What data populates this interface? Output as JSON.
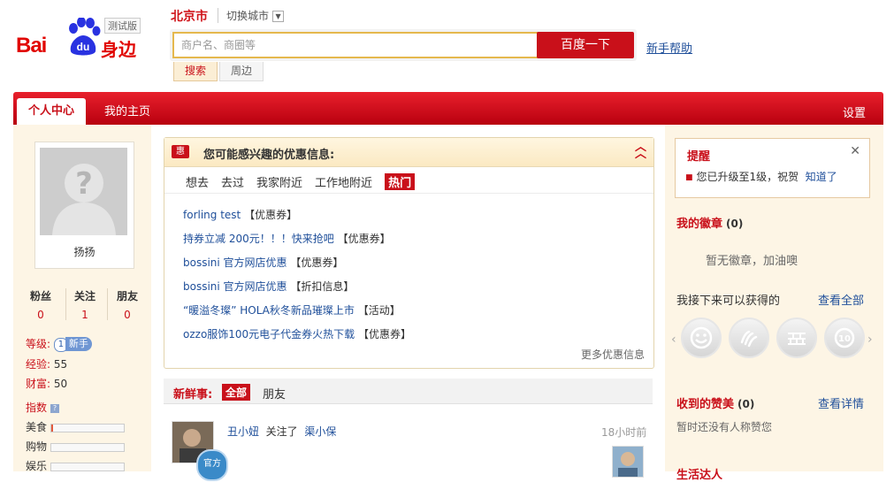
{
  "header": {
    "logo_text_bai": "Bai",
    "logo_text_du": "du",
    "logo_text_shen": "身边",
    "beta_badge": "测试版",
    "city": "北京市",
    "switch_city": "切换城市",
    "search_placeholder": "商户名、商圈等",
    "search_button": "百度一下",
    "help_link": "新手帮助",
    "tabs": [
      {
        "label": "搜索"
      },
      {
        "label": "周边"
      }
    ]
  },
  "nav": {
    "active_tab": "个人中心",
    "home_tab": "我的主页",
    "settings": "设置"
  },
  "profile": {
    "name": "扬扬",
    "stats": [
      {
        "label": "粉丝",
        "value": "0"
      },
      {
        "label": "关注",
        "value": "1"
      },
      {
        "label": "朋友",
        "value": "0"
      }
    ],
    "level_label": "等级:",
    "level_num": "1",
    "level_name": "新手",
    "exp_label": "经验:",
    "exp_value": "55",
    "wealth_label": "财富:",
    "wealth_value": "50",
    "index_label": "指数",
    "index_help": "?",
    "indexes": [
      {
        "label": "美食",
        "value": 0.03
      },
      {
        "label": "购物",
        "value": 0.0
      },
      {
        "label": "娱乐",
        "value": 0.0
      }
    ]
  },
  "deals": {
    "badge": "惠",
    "title": "您可能感兴趣的优惠信息:",
    "collapse_icon": "double-chevron-up",
    "filters": [
      "想去",
      "去过",
      "我家附近",
      "工作地附近",
      "热门"
    ],
    "items": [
      {
        "title": "forling test",
        "tag": "【优惠券】"
      },
      {
        "title": "持券立减  200元！！！快来抢吧",
        "tag": "【优惠券】"
      },
      {
        "title": "bossini 官方网店优惠",
        "tag": "【优惠券】"
      },
      {
        "title": "bossini 官方网店优惠",
        "tag": "【折扣信息】"
      },
      {
        "title": "“暖溢冬璨” HOLA秋冬新品璀璨上市",
        "tag": "【活动】"
      },
      {
        "title": "ozzo服饰100元电子代金券火热下载",
        "tag": "【优惠券】"
      }
    ],
    "more": "更多优惠信息"
  },
  "feed": {
    "label": "新鲜事:",
    "tab_all": "全部",
    "tab_friends": "朋友",
    "official_badge": "官方",
    "item": {
      "user": "丑小妞",
      "action": "关注了",
      "target": "渠小保",
      "time": "18小时前"
    }
  },
  "reminder": {
    "title": "提醒",
    "close": "✕",
    "text": "您已升级至1级，祝贺",
    "ack": "知道了"
  },
  "badges": {
    "title": "我的徽章",
    "count": "(0)",
    "empty": "暂无徽章，加油噢",
    "next_label": "我接下来可以获得的",
    "view_all": "查看全部"
  },
  "likes": {
    "title": "收到的赞美",
    "count": "(0)",
    "view_detail": "查看详情",
    "empty": "暂时还没有人称赞您",
    "next_title": "生活达人"
  },
  "colors": {
    "brand_red": "#c9101a",
    "link_blue": "#1f4f9a",
    "side_bg": "#fdf5e5"
  }
}
